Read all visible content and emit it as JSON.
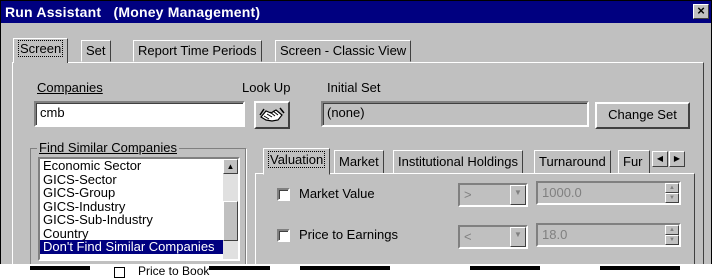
{
  "window": {
    "title": "Run Assistant   (Money Management)",
    "close_glyph": "×"
  },
  "tabs": [
    "Screen",
    "Set",
    "Report Time Periods",
    "Screen - Classic View"
  ],
  "companies": {
    "label": "Companies",
    "value": "cmb"
  },
  "lookup": {
    "label": "Look Up"
  },
  "initial_set": {
    "label": "Initial Set",
    "value": "(none)",
    "button": "Change Set"
  },
  "find_similar": {
    "label": "Find Similar Companies",
    "items": [
      "Economic Sector",
      "GICS-Sector",
      "GICS-Group",
      "GICS-Industry",
      "GICS-Sub-Industry",
      "Country",
      "Don't Find Similar Companies"
    ],
    "selected_index": 6
  },
  "subtabs": [
    "Valuation",
    "Market",
    "Institutional Holdings",
    "Turnaround",
    "Fur"
  ],
  "criteria": [
    {
      "label": "Market Value",
      "operator": ">",
      "value": "1000.0"
    },
    {
      "label": "Price to Earnings",
      "operator": "<",
      "value": "18.0"
    }
  ],
  "overflow": {
    "partial_label": "Price to Book"
  },
  "colors": {
    "titlebar": "#000080",
    "face": "#c0c0c0",
    "selection": "#000080"
  },
  "icons": [
    "close-icon",
    "handshake-icon",
    "scroll-up-icon",
    "tab-scroll-left-icon",
    "tab-scroll-right-icon",
    "dropdown-arrow-icon",
    "spin-up-icon",
    "spin-down-icon"
  ]
}
